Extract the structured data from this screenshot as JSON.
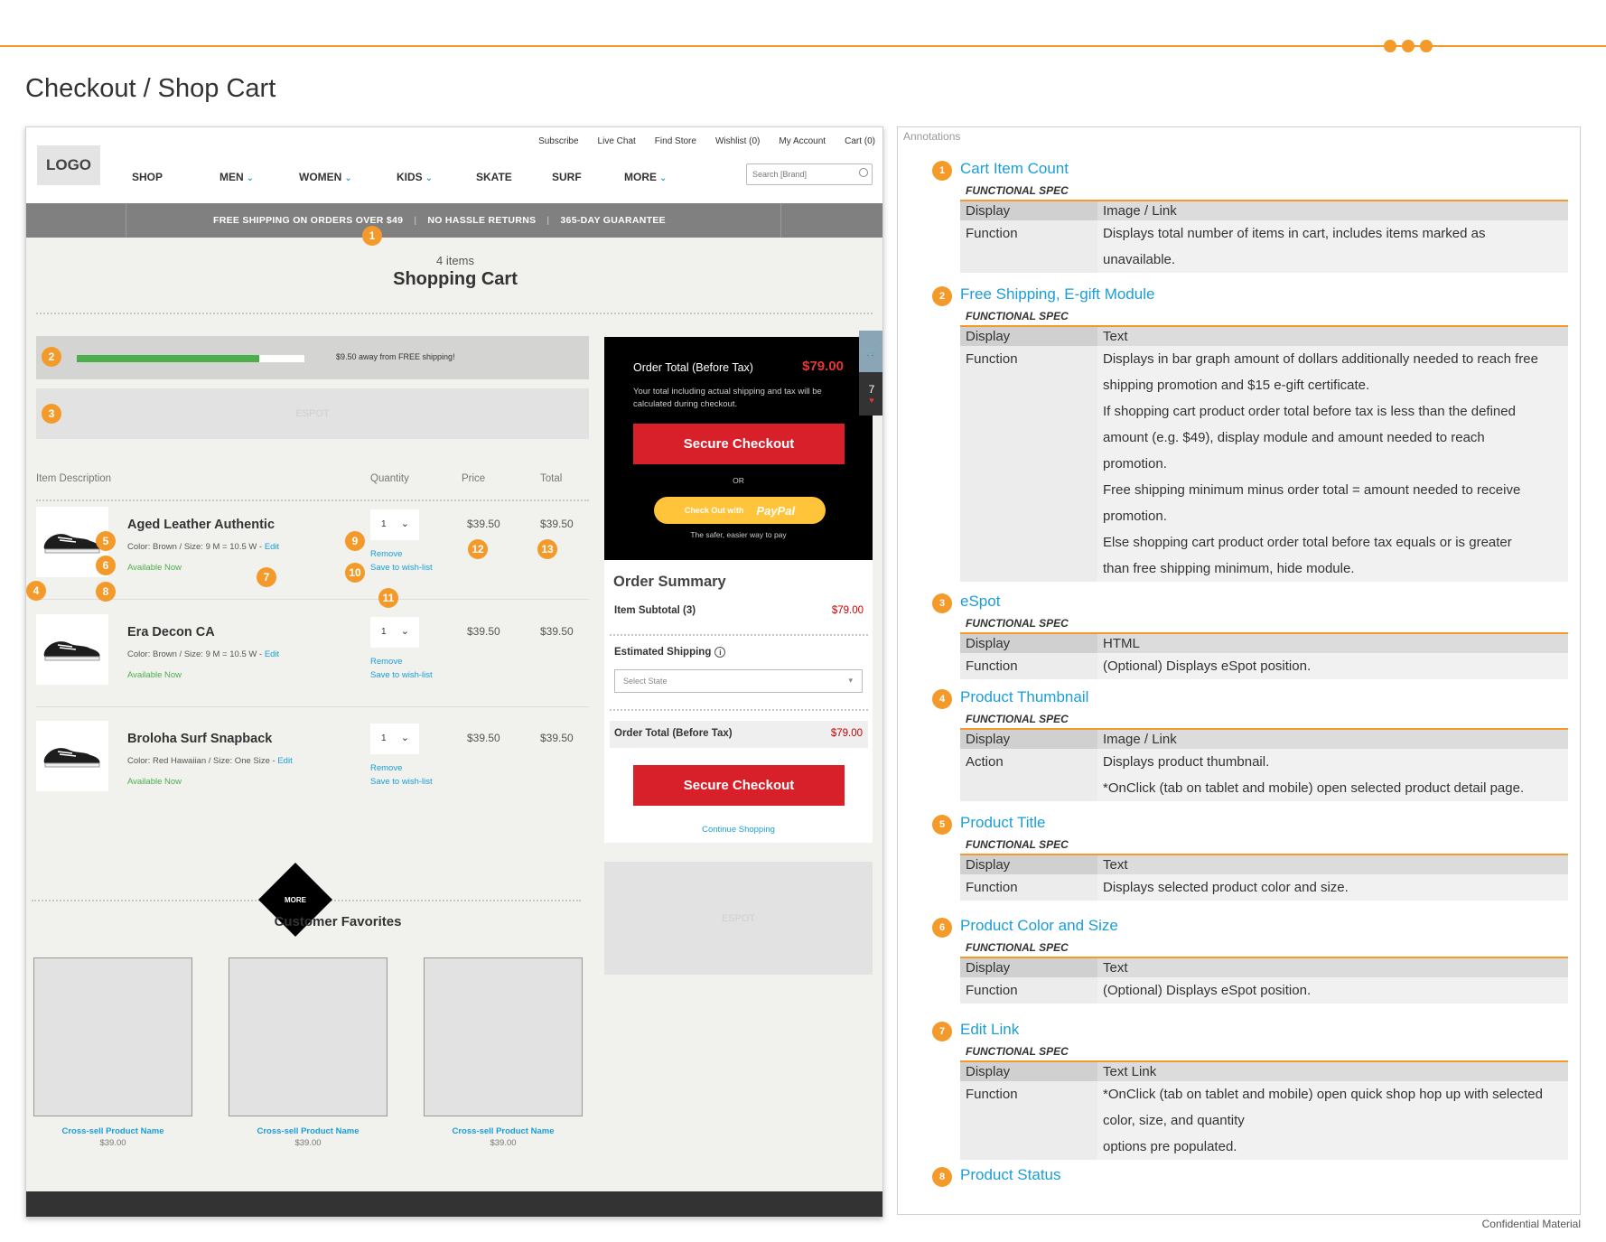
{
  "page_title": "Checkout / Shop Cart",
  "confidential": "Confidential Material",
  "header": {
    "logo": "LOGO",
    "utility": [
      "Subscribe",
      "Live Chat",
      "Find Store",
      "Wishlist (0)",
      "My Account",
      "Cart (0)"
    ],
    "nav": [
      {
        "label": "SHOP",
        "chevron": false
      },
      {
        "label": "MEN",
        "chevron": true
      },
      {
        "label": "WOMEN",
        "chevron": true
      },
      {
        "label": "KIDS",
        "chevron": true
      },
      {
        "label": "SKATE",
        "chevron": false
      },
      {
        "label": "SURF",
        "chevron": false
      },
      {
        "label": "MORE",
        "chevron": true
      }
    ],
    "search_placeholder": "Search [Brand]"
  },
  "promo": [
    "FREE SHIPPING ON ORDERS OVER $49",
    "NO HASSLE RETURNS",
    "365-DAY GUARANTEE"
  ],
  "cart": {
    "count": "4 items",
    "title": "Shopping Cart",
    "shipping_text": "$9.50 away from FREE shipping!",
    "shipping_progress": 0.8,
    "espot": "ESPOT",
    "columns": {
      "desc": "Item Description",
      "qty": "Quantity",
      "price": "Price",
      "total": "Total"
    },
    "items": [
      {
        "name": "Aged Leather Authentic",
        "meta": "Color: Brown  / Size: 9 M = 10.5 W",
        "edit": "Edit",
        "status": "Available Now",
        "qty": "1",
        "remove": "Remove",
        "wish": "Save to wish-list",
        "price": "$39.50",
        "total": "$39.50"
      },
      {
        "name": "Era Decon CA",
        "meta": "Color: Brown  / Size: 9 M = 10.5 W",
        "edit": "Edit",
        "status": "Available Now",
        "qty": "1",
        "remove": "Remove",
        "wish": "Save to wish-list",
        "price": "$39.50",
        "total": "$39.50"
      },
      {
        "name": "Broloha Surf Snapback",
        "meta": "Color: Red Hawaiian  / Size: One Size",
        "edit": "Edit",
        "status": "Available Now",
        "qty": "1",
        "remove": "Remove",
        "wish": "Save to wish-list",
        "price": "$39.50",
        "total": "$39.50"
      }
    ],
    "more": "MORE",
    "favorites_title": "Customer Favorites",
    "crosssell": [
      {
        "name": "Cross-sell Product Name",
        "price": "$39.00"
      },
      {
        "name": "Cross-sell Product Name",
        "price": "$39.00"
      },
      {
        "name": "Cross-sell Product Name",
        "price": "$39.00"
      }
    ]
  },
  "checkout": {
    "order_total_label": "Order Total (Before Tax)",
    "order_total_value": "$79.00",
    "note": "Your total including actual shipping and tax will be calculated during checkout.",
    "secure_checkout": "Secure Checkout",
    "or": "OR",
    "paypal_prefix": "Check Out with",
    "paypal_brand": "PayPal",
    "paypal_tagline": "The safer, easier way to pay",
    "side_count": "7"
  },
  "summary": {
    "title": "Order Summary",
    "subtotal_label": "Item Subtotal (3)",
    "subtotal_value": "$79.00",
    "shipping_label": "Estimated Shipping",
    "select_state": "Select State",
    "total_label": "Order Total (Before Tax)",
    "total_value": "$79.00",
    "secure_checkout": "Secure Checkout",
    "continue": "Continue Shopping",
    "espot": "ESPOT"
  },
  "annotations": {
    "heading": "Annotations",
    "functional_spec": "FUNCTIONAL SPEC",
    "items": [
      {
        "num": "1",
        "title": "Cart Item Count",
        "rows": [
          [
            "Display",
            "Image / Link"
          ],
          [
            "Function",
            "Displays total number of items in cart, includes items marked as",
            "unavailable."
          ]
        ]
      },
      {
        "num": "2",
        "title": "Free Shipping, E-gift Module",
        "rows": [
          [
            "Display",
            "Text"
          ],
          [
            "Function",
            "Displays in bar graph amount of dollars additionally needed to reach free",
            "shipping promotion and $15 e-gift certificate.",
            "If shopping cart product order total before tax is less than the defined",
            "amount (e.g. $49), display module and amount needed to reach",
            "promotion.",
            "Free shipping minimum minus order total = amount needed to receive",
            "promotion.",
            "Else shopping cart product order total before tax equals or is greater",
            "than free shipping minimum, hide module."
          ]
        ]
      },
      {
        "num": "3",
        "title": "eSpot",
        "rows": [
          [
            "Display",
            "HTML"
          ],
          [
            "Function",
            "(Optional) Displays eSpot position."
          ]
        ]
      },
      {
        "num": "4",
        "title": "Product Thumbnail",
        "rows": [
          [
            "Display",
            "Image / Link"
          ],
          [
            "Action",
            "Displays product thumbnail.",
            "*OnClick (tab on tablet and mobile) open selected product detail page."
          ]
        ]
      },
      {
        "num": "5",
        "title": "Product Title",
        "rows": [
          [
            "Display",
            "Text"
          ],
          [
            "Function",
            "Displays selected product color and size."
          ]
        ]
      },
      {
        "num": "6",
        "title": "Product Color and Size",
        "rows": [
          [
            "Display",
            "Text"
          ],
          [
            "Function",
            "(Optional) Displays eSpot position."
          ]
        ]
      },
      {
        "num": "7",
        "title": "Edit Link",
        "rows": [
          [
            "Display",
            "Text Link"
          ],
          [
            "Function",
            "*OnClick (tab on tablet and mobile) open quick shop hop up with selected",
            "color, size, and quantity",
            "options pre populated."
          ]
        ]
      },
      {
        "num": "8",
        "title": "Product Status",
        "rows": []
      }
    ]
  }
}
